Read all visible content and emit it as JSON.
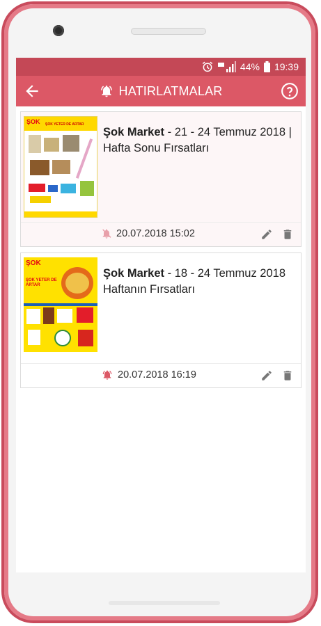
{
  "status_bar": {
    "battery": "44%",
    "time": "19:39"
  },
  "app_bar": {
    "title": "HATIRLATMALAR"
  },
  "reminders": [
    {
      "store": "Şok Market",
      "title_rest": " - 21 - 24 Temmuz 2018 | Hafta Sonu Fırsatları",
      "flyer_banner": "ŞOK YETER DE ARTAR",
      "datetime": "20.07.2018 15:02",
      "bell_muted": true
    },
    {
      "store": "Şok Market",
      "title_rest": " - 18 - 24 Temmuz 2018 Haftanın Fırsatları",
      "flyer_banner": "ŞOK YETER DE ARTAR",
      "datetime": "20.07.2018 16:19",
      "bell_muted": false
    }
  ],
  "colors": {
    "accent": "#dc5866",
    "status": "#c44856",
    "frame": "#c94b5c"
  }
}
